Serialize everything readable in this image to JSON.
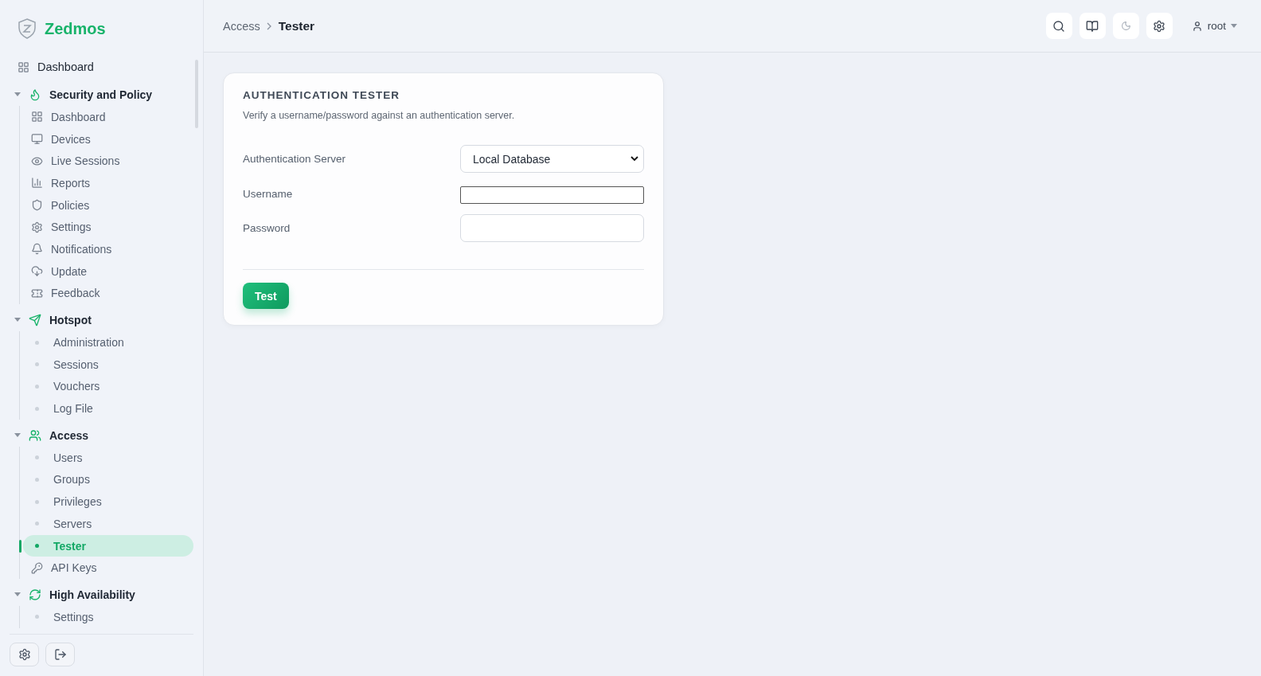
{
  "brand": {
    "name": "Zedmos"
  },
  "sidebar": {
    "items": [
      {
        "kind": "link",
        "label": "Dashboard",
        "selected": false
      },
      {
        "kind": "section",
        "label": "Security and Policy",
        "expanded": true,
        "children": [
          {
            "kind": "icon",
            "label": "Dashboard",
            "selected": false
          },
          {
            "kind": "icon",
            "label": "Devices",
            "selected": false
          },
          {
            "kind": "icon",
            "label": "Live Sessions",
            "selected": false
          },
          {
            "kind": "icon",
            "label": "Reports",
            "selected": false
          },
          {
            "kind": "icon",
            "label": "Policies",
            "selected": false
          },
          {
            "kind": "icon",
            "label": "Settings",
            "selected": false
          },
          {
            "kind": "icon",
            "label": "Notifications",
            "selected": false
          },
          {
            "kind": "icon",
            "label": "Update",
            "selected": false
          },
          {
            "kind": "icon",
            "label": "Feedback",
            "selected": false
          }
        ]
      },
      {
        "kind": "section",
        "label": "Hotspot",
        "expanded": true,
        "children": [
          {
            "kind": "dot",
            "label": "Administration",
            "selected": false
          },
          {
            "kind": "dot",
            "label": "Sessions",
            "selected": false
          },
          {
            "kind": "dot",
            "label": "Vouchers",
            "selected": false
          },
          {
            "kind": "dot",
            "label": "Log File",
            "selected": false
          }
        ]
      },
      {
        "kind": "section",
        "label": "Access",
        "expanded": true,
        "children": [
          {
            "kind": "dot",
            "label": "Users",
            "selected": false
          },
          {
            "kind": "dot",
            "label": "Groups",
            "selected": false
          },
          {
            "kind": "dot",
            "label": "Privileges",
            "selected": false
          },
          {
            "kind": "dot",
            "label": "Servers",
            "selected": false
          },
          {
            "kind": "dot",
            "label": "Tester",
            "selected": true
          },
          {
            "kind": "icon",
            "label": "API Keys",
            "selected": false
          }
        ]
      },
      {
        "kind": "section",
        "label": "High Availability",
        "expanded": true,
        "children": [
          {
            "kind": "dot",
            "label": "Settings",
            "selected": false
          }
        ]
      }
    ]
  },
  "breadcrumb": [
    "Access",
    "Tester"
  ],
  "user": {
    "name": "root"
  },
  "card": {
    "title": "AUTHENTICATION TESTER",
    "subtitle": "Verify a username/password against an authentication server.",
    "fields": [
      {
        "kind": "select",
        "label": "Authentication Server",
        "value": "Local Database"
      },
      {
        "kind": "plain",
        "label": "Username"
      },
      {
        "kind": "password",
        "label": "Password"
      }
    ],
    "button": "Test"
  }
}
